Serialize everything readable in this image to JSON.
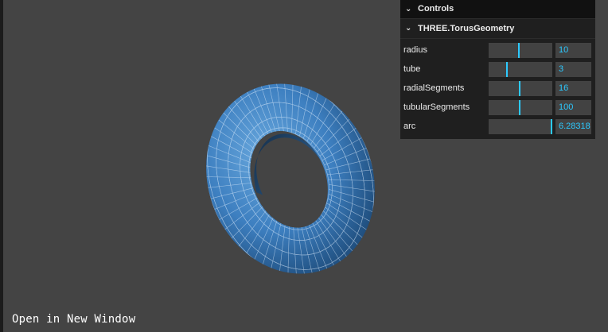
{
  "link": {
    "open_new_window": "Open in New Window"
  },
  "gui": {
    "title": "Controls",
    "folder_title": "THREE.TorusGeometry",
    "accent_color": "#2cc9ff",
    "params": [
      {
        "label": "radius",
        "value": "10",
        "fraction": 0.48
      },
      {
        "label": "tube",
        "value": "3",
        "fraction": 0.29
      },
      {
        "label": "radialSegments",
        "value": "16",
        "fraction": 0.49
      },
      {
        "label": "tubularSegments",
        "value": "100",
        "fraction": 0.49
      },
      {
        "label": "arc",
        "value": "6.28318",
        "fraction": 1.0
      }
    ]
  },
  "scene": {
    "background_color": "#444444",
    "mesh_color": "#3d7fc0",
    "wire_color": "#e6f2ff"
  }
}
